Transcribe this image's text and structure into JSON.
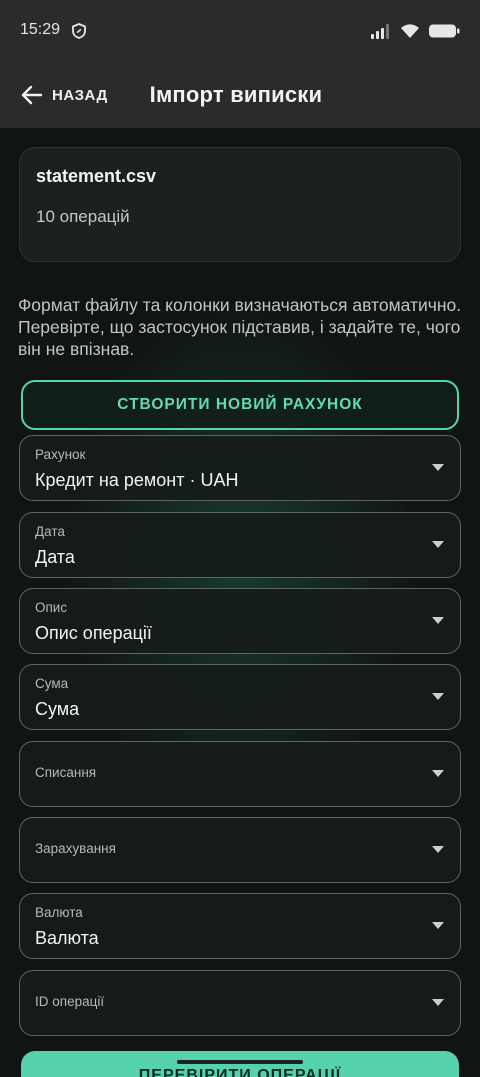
{
  "status": {
    "time": "15:29"
  },
  "header": {
    "back_label": "НАЗАД",
    "title": "Імпорт виписки"
  },
  "file": {
    "name": "statement.csv",
    "count": "10 операцій"
  },
  "hint": "Формат файлу та колонки визначаються автоматично. Перевірте, що застосунок підставив, і задайте те, чого він не впізнав.",
  "create_button": "СТВОРИТИ НОВИЙ РАХУНОК",
  "fields": [
    {
      "label": "Рахунок",
      "value": "Кредит на ремонт · UAH"
    },
    {
      "label": "Дата",
      "value": "Дата"
    },
    {
      "label": "Опис",
      "value": "Опис операції"
    },
    {
      "label": "Сума",
      "value": "Сума"
    },
    {
      "label": "Списання",
      "value": ""
    },
    {
      "label": "Зарахування",
      "value": ""
    },
    {
      "label": "Валюта",
      "value": "Валюта"
    },
    {
      "label": "ID операції",
      "value": ""
    }
  ],
  "verify_button": "ПЕРЕВІРИТИ ОПЕРАЦІЇ",
  "colors": {
    "accent": "#53d6ad",
    "background": "#101413",
    "appbar": "#2b2b2b"
  },
  "icons": [
    "shield-icon",
    "signal-icon",
    "wifi-icon",
    "battery-icon",
    "back-arrow-icon",
    "dropdown-arrow-icon"
  ]
}
